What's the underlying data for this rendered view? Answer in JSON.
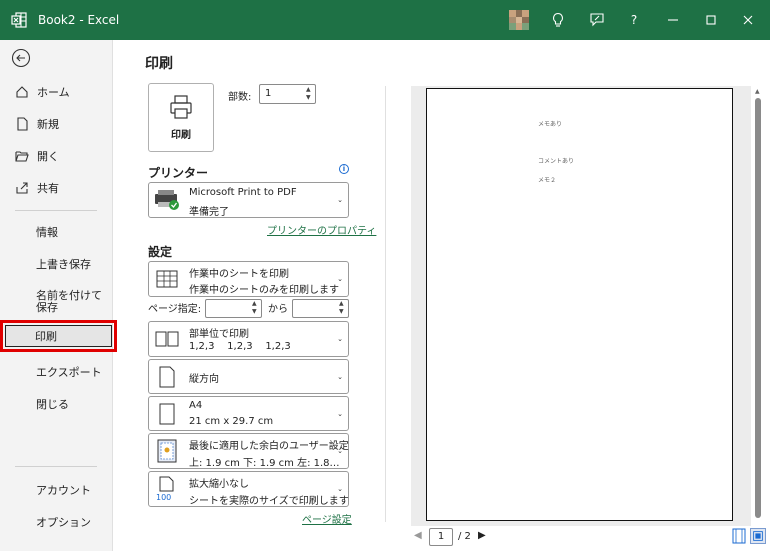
{
  "titlebar": {
    "title": "Book2  -  Excel",
    "help": "?"
  },
  "nav": {
    "home": "ホーム",
    "new": "新規",
    "open": "開く",
    "share": "共有",
    "info": "情報",
    "save": "上書き保存",
    "save_as": "名前を付けて保存",
    "print": "印刷",
    "export": "エクスポート",
    "close": "閉じる",
    "account": "アカウント",
    "options": "オプション"
  },
  "print": {
    "title": "印刷",
    "button_label": "印刷",
    "copies_label": "部数:",
    "copies_value": "1"
  },
  "printer": {
    "section": "プリンター",
    "name": "Microsoft Print to PDF",
    "status": "準備完了",
    "properties_link": "プリンターのプロパティ"
  },
  "settings": {
    "section": "設定",
    "scope_title": "作業中のシートを印刷",
    "scope_desc": "作業中のシートのみを印刷します",
    "pages_label": "ページ指定:",
    "to_label": "から",
    "collate_title": "部単位で印刷",
    "collate_desc": "1,2,3    1,2,3    1,2,3",
    "orientation": "縦方向",
    "paper_title": "A4",
    "paper_desc": "21 cm x 29.7 cm",
    "margins_title": "最後に適用した余白のユーザー設定",
    "margins_desc": "上: 1.9 cm 下: 1.9 cm 左: 1.8…",
    "scaling_title": "拡大縮小なし",
    "scaling_desc": "シートを実際のサイズで印刷します",
    "scaling_icon_text": "100",
    "page_setup_link": "ページ設定"
  },
  "preview": {
    "memo1": "メモあり",
    "comment": "コメントあり",
    "memo2": "メモ２",
    "current_page": "1",
    "total_pages": "/ 2"
  }
}
